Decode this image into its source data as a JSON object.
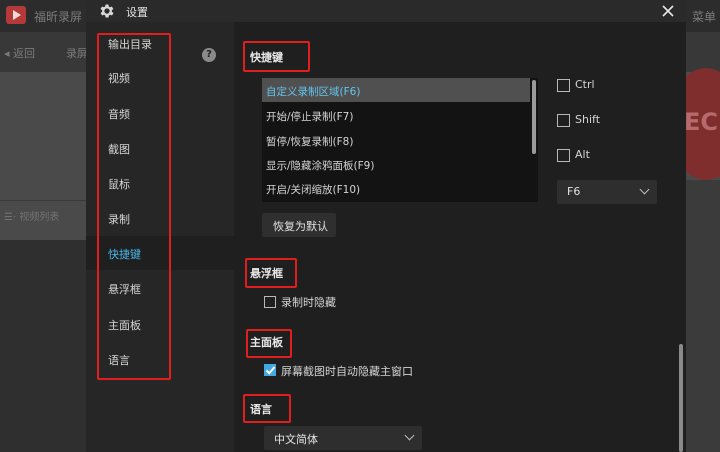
{
  "background_app": {
    "title": "福昕录屏",
    "menu": "菜单",
    "back": "◂ 返回",
    "rec_tab": "录屏",
    "video_list": "☰· 视频列表",
    "rec_text": "EC"
  },
  "dialog": {
    "title": "设置"
  },
  "nav": {
    "items": [
      {
        "label": "输出目录"
      },
      {
        "label": "视频"
      },
      {
        "label": "音频"
      },
      {
        "label": "截图"
      },
      {
        "label": "鼠标"
      },
      {
        "label": "录制"
      },
      {
        "label": "快捷键"
      },
      {
        "label": "悬浮框"
      },
      {
        "label": "主面板"
      },
      {
        "label": "语言"
      }
    ],
    "active": "快捷键"
  },
  "hotkeys": {
    "title": "快捷键",
    "help": "?",
    "items": [
      {
        "label": "自定义录制区域(F6)"
      },
      {
        "label": "开始/停止录制(F7)"
      },
      {
        "label": "暂停/恢复录制(F8)"
      },
      {
        "label": "显示/隐藏涂鸦面板(F9)"
      },
      {
        "label": "开启/关闭缩放(F10)"
      }
    ],
    "modifiers": [
      {
        "label": "Ctrl",
        "checked": false
      },
      {
        "label": "Shift",
        "checked": false
      },
      {
        "label": "Alt",
        "checked": false
      }
    ],
    "key_value": "F6",
    "reset_label": "恢复为默认"
  },
  "float_window": {
    "title": "悬浮框",
    "hide_label": "录制时隐藏",
    "hide_checked": false
  },
  "main_panel": {
    "title": "主面板",
    "auto_hide_label": "屏幕截图时自动隐藏主窗口",
    "auto_hide_checked": true
  },
  "language": {
    "title": "语言",
    "value": "中文简体"
  },
  "colors": {
    "accent": "#4ab7e6",
    "annotation": "#e01e1e",
    "checkbox_checked": "#43a9e0"
  }
}
